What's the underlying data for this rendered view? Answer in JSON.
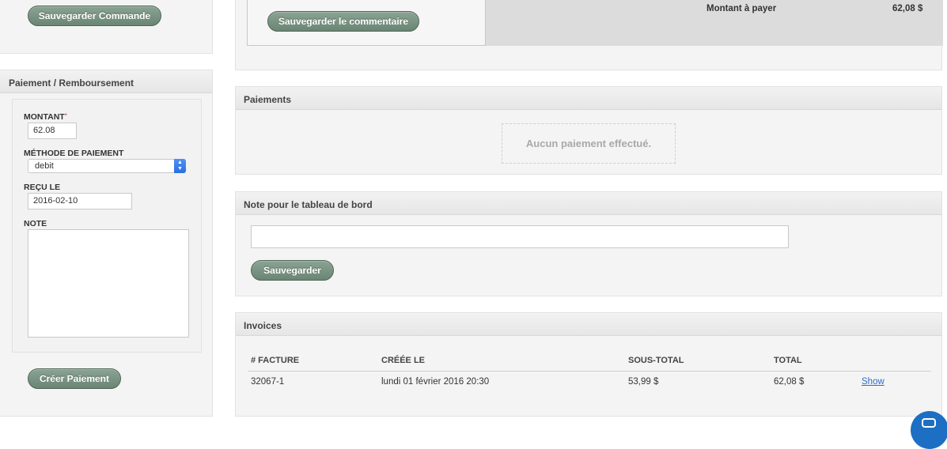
{
  "left": {
    "save_order_label": "Sauvegarder Commande",
    "payment_panel": {
      "title": "Paiement / Remboursement",
      "amount_label": "MONTANT",
      "amount_required_mark": "*",
      "amount_value": "62.08",
      "method_label": "MÉTHODE DE PAIEMENT",
      "method_value": "debit",
      "received_label": "REÇU LE",
      "received_value": "2016-02-10",
      "note_label": "NOTE",
      "note_value": "",
      "create_label": "Créer Paiement"
    }
  },
  "top": {
    "save_comment_label": "Sauvegarder le commentaire",
    "amount_due_label": "Montant à payer",
    "amount_due_value": "62,08 $"
  },
  "payments": {
    "title": "Paiements",
    "empty_text": "Aucun paiement effectué."
  },
  "dashboard_note": {
    "title": "Note pour le tableau de bord",
    "value": "",
    "save_label": "Sauvegarder"
  },
  "invoices": {
    "title": "Invoices",
    "columns": [
      "# FACTURE",
      "CRÉÉE LE",
      "SOUS-TOTAL",
      "TOTAL"
    ],
    "rows": [
      {
        "number": "32067-1",
        "created": "lundi 01 février 2016 20:30",
        "subtotal": "53,99 $",
        "total": "62,08 $",
        "action": "Show"
      }
    ]
  },
  "colors": {
    "button_green": "#6b8574",
    "panel_bg": "#f4f4f4",
    "header_bg": "#e6e6e6",
    "link_blue": "#2a6fc9",
    "chat_blue": "#1c6fc2"
  },
  "icons": {
    "select_arrows": "updown-chevron-icon",
    "chat_bubble": "chat-bubble-icon"
  }
}
